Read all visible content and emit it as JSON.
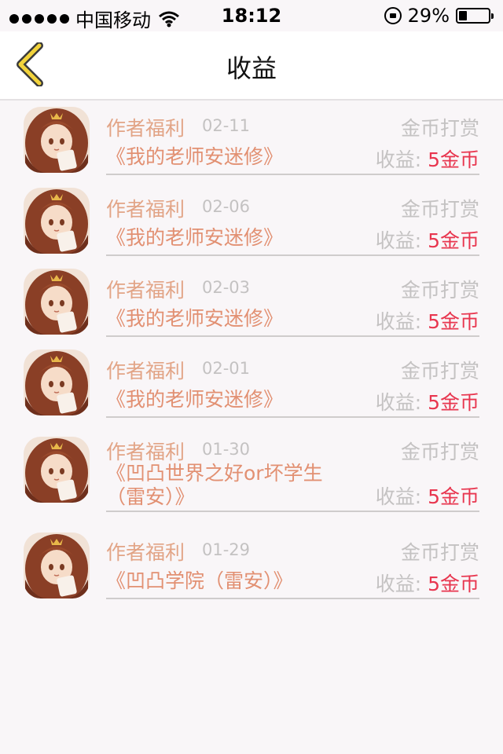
{
  "status_bar": {
    "carrier": "中国移动",
    "time": "18:12",
    "battery_percent": "29%",
    "battery_level": 0.29,
    "icons": [
      "signal-dots-icon",
      "wifi-icon",
      "rotation-lock-icon",
      "battery-icon"
    ]
  },
  "nav": {
    "title": "收益",
    "back_icon": "chevron-left-icon",
    "accent": "#f2d33b"
  },
  "income": {
    "items": [
      {
        "source": "作者福利",
        "date": "02-11",
        "type": "金币打赏",
        "book": "《我的老师安迷修》",
        "earn_label": "收益:",
        "earn_value": "5金币"
      },
      {
        "source": "作者福利",
        "date": "02-06",
        "type": "金币打赏",
        "book": "《我的老师安迷修》",
        "earn_label": "收益:",
        "earn_value": "5金币"
      },
      {
        "source": "作者福利",
        "date": "02-03",
        "type": "金币打赏",
        "book": "《我的老师安迷修》",
        "earn_label": "收益:",
        "earn_value": "5金币"
      },
      {
        "source": "作者福利",
        "date": "02-01",
        "type": "金币打赏",
        "book": "《我的老师安迷修》",
        "earn_label": "收益:",
        "earn_value": "5金币"
      },
      {
        "source": "作者福利",
        "date": "01-30",
        "type": "金币打赏",
        "book": "《凹凸世界之好or坏学生（雷安）》",
        "earn_label": "收益:",
        "earn_value": "5金币"
      },
      {
        "source": "作者福利",
        "date": "01-29",
        "type": "金币打赏",
        "book": "《凹凸学院（雷安）》",
        "earn_label": "收益:",
        "earn_value": "5金币"
      }
    ]
  },
  "colors": {
    "source_text": "#e2a486",
    "book_text": "#e29072",
    "muted_text": "#c4c2c2",
    "earn_value": "#e8364f",
    "background": "#f9f6f8"
  }
}
